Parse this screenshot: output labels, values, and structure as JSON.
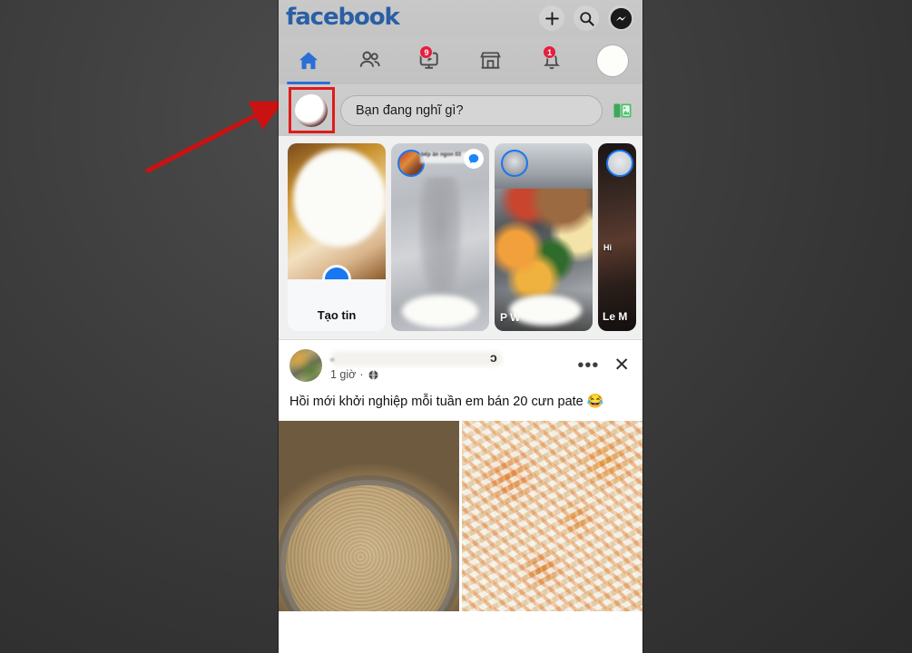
{
  "app": {
    "name": "Facebook",
    "logo_text": "facebook",
    "logo_color": "#2a5fa5"
  },
  "topbar": {
    "actions": [
      {
        "name": "add-icon",
        "label": "+"
      },
      {
        "name": "search-icon",
        "label": "Tìm kiếm"
      },
      {
        "name": "messenger-icon",
        "label": "Messenger"
      }
    ]
  },
  "nav": {
    "tabs": [
      {
        "name": "tab-home",
        "label": "Trang chủ",
        "icon": "home-icon",
        "active": true,
        "badge": ""
      },
      {
        "name": "tab-friends",
        "label": "Bạn bè",
        "icon": "friends-icon",
        "active": false,
        "badge": ""
      },
      {
        "name": "tab-video",
        "label": "Video",
        "icon": "video-icon",
        "active": false,
        "badge": "9"
      },
      {
        "name": "tab-marketplace",
        "label": "Marketplace",
        "icon": "store-icon",
        "active": false,
        "badge": ""
      },
      {
        "name": "tab-notifications",
        "label": "Thông báo",
        "icon": "bell-icon",
        "active": false,
        "badge": "1"
      },
      {
        "name": "tab-menu",
        "label": "Menu",
        "icon": "avatar-icon",
        "active": false,
        "badge": ""
      }
    ],
    "active_accent": "#2a6fd6"
  },
  "composer": {
    "placeholder": "Bạn đang nghĩ gì?",
    "avatar_name": "profile-avatar",
    "photo_button_label": "Ảnh"
  },
  "stories": [
    {
      "type": "create",
      "label": "Tạo tin",
      "plus_color": "#1877f2"
    },
    {
      "type": "story",
      "label": "",
      "overlay_name": "bếp ăn ngon 03",
      "has_message_badge": true
    },
    {
      "type": "story",
      "label": "P                 W"
    },
    {
      "type": "story",
      "label": "Le M",
      "caption": "Hi",
      "partial": true
    }
  ],
  "post": {
    "author_visible_tail": "ɔ",
    "author_visible_lead": "-",
    "time": "1 giờ",
    "privacy_icon": "globe-icon",
    "separator": "·",
    "menu_label": "•••",
    "close_label": "✕",
    "text": "Hồi mới khởi nghiệp mỗi tuần em bán 20 cưn pate ",
    "emoji": "😂",
    "photos": [
      {
        "name": "post-photo-pate",
        "alt": "Nồi pate"
      },
      {
        "name": "post-photo-kimchi",
        "alt": "Kim chi cải thảo"
      }
    ]
  },
  "annotation": {
    "highlight_color": "#e01b1b",
    "arrow_color": "#cc1111",
    "target": "composer-avatar"
  },
  "background": {
    "color": "#333333"
  }
}
